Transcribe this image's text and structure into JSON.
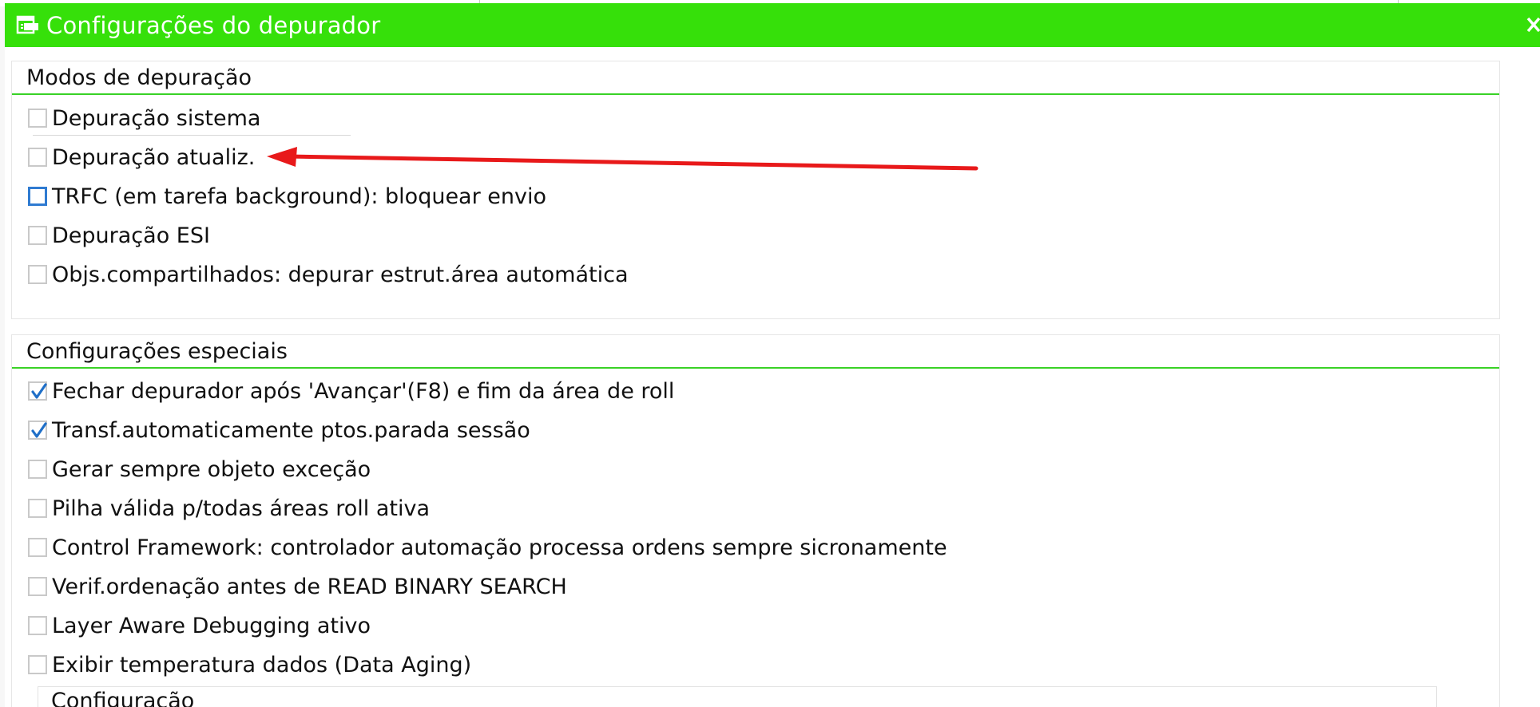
{
  "window": {
    "title": "Configurações do depurador"
  },
  "icons": {
    "title": "dialog-settings-icon",
    "close": "close-icon",
    "checkmark": "checkmark-icon"
  },
  "colors": {
    "titlebar": "#36e00a",
    "group_underline": "#39d226",
    "checkbox_border": "#c9c9c9",
    "focus_border": "#2f7bd1",
    "check_mark": "#1f6fc8",
    "annotation_arrow": "#e8191a"
  },
  "debug_modes": {
    "title": "Modos de depuração",
    "items": [
      {
        "label": "Depuração sistema",
        "checked": false
      },
      {
        "label": "Depuração atualiz.",
        "checked": false
      },
      {
        "label": "TRFC (em tarefa background): bloquear envio",
        "checked": false,
        "focused": true
      },
      {
        "label": "Depuração ESI",
        "checked": false
      },
      {
        "label": "Objs.compartilhados: depurar estrut.área automática",
        "checked": false
      }
    ]
  },
  "special_settings": {
    "title": "Configurações especiais",
    "items": [
      {
        "label": "Fechar depurador após 'Avançar'(F8) e fim da área de roll",
        "checked": true
      },
      {
        "label": "Transf.automaticamente ptos.parada sessão",
        "checked": true
      },
      {
        "label": "Gerar sempre objeto exceção",
        "checked": false
      },
      {
        "label": "Pilha válida p/todas áreas roll ativa",
        "checked": false
      },
      {
        "label": "Control Framework: controlador automação processa ordens sempre sicronamente",
        "checked": false
      },
      {
        "label": "Verif.ordenação antes de READ BINARY SEARCH",
        "checked": false
      },
      {
        "label": "Layer Aware Debugging ativo",
        "checked": false
      },
      {
        "label": "Exibir temperatura dados (Data Aging)",
        "checked": false
      }
    ],
    "subgroup_title": "Configuração"
  }
}
